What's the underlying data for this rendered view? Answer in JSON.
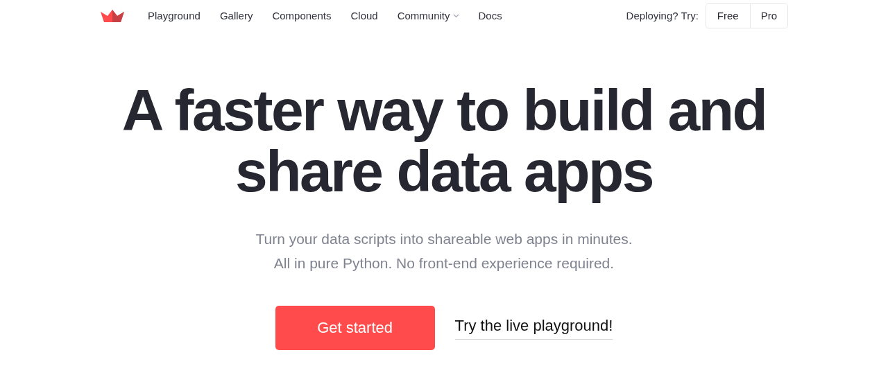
{
  "nav": {
    "items": [
      {
        "label": "Playground",
        "has_menu": false
      },
      {
        "label": "Gallery",
        "has_menu": false
      },
      {
        "label": "Components",
        "has_menu": false
      },
      {
        "label": "Cloud",
        "has_menu": false
      },
      {
        "label": "Community",
        "has_menu": true
      },
      {
        "label": "Docs",
        "has_menu": false
      }
    ],
    "deploy_prompt": "Deploying? Try:",
    "deploy_options": [
      "Free",
      "Pro"
    ]
  },
  "hero": {
    "headline_lines": [
      "A faster way to build and",
      "share data apps"
    ],
    "subtitle_lines": [
      "Turn your data scripts into shareable web apps in minutes.",
      "All in pure Python. No front-end experience required."
    ],
    "primary_button": "Get started",
    "secondary_link": "Try the live playground!"
  }
}
